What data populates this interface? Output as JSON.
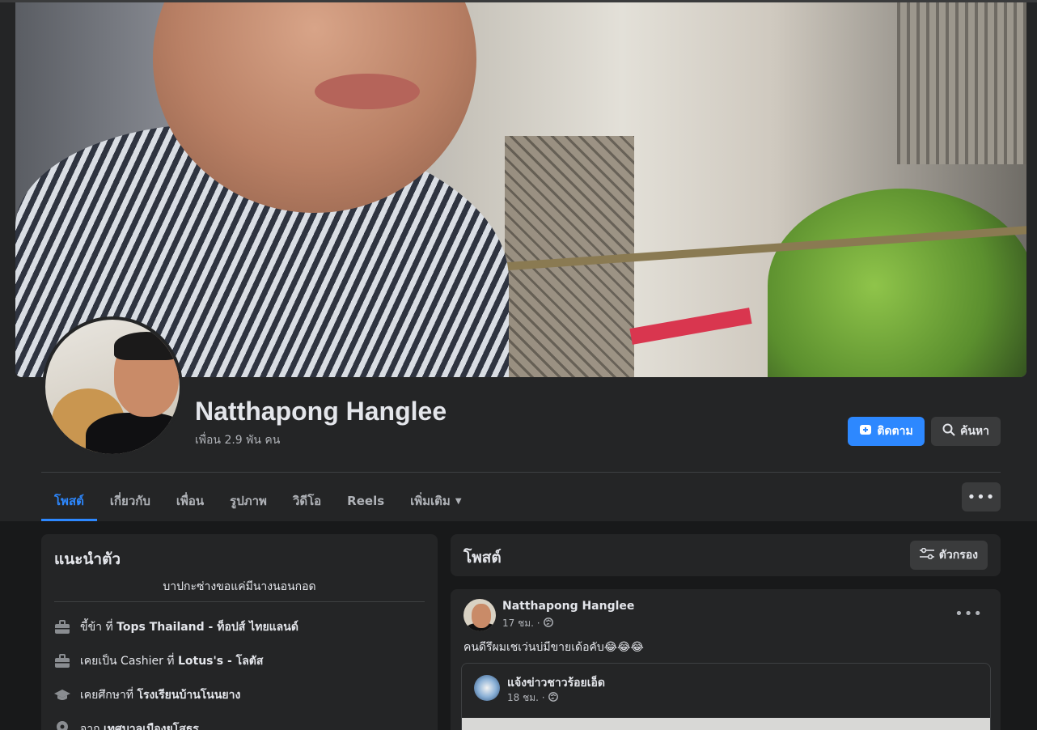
{
  "profile": {
    "name": "Natthapong Hanglee",
    "friends": "เพื่อน 2.9 พัน คน"
  },
  "actions": {
    "follow_label": "ติดตาม",
    "search_label": "ค้นหา",
    "more_label": "•••"
  },
  "tabs": [
    {
      "label": "โพสต์",
      "active": true
    },
    {
      "label": "เกี่ยวกับ"
    },
    {
      "label": "เพื่อน"
    },
    {
      "label": "รูปภาพ"
    },
    {
      "label": "วิดีโอ"
    },
    {
      "label": "Reels"
    },
    {
      "label": "เพิ่มเติม"
    }
  ],
  "intro": {
    "title": "แนะนำตัว",
    "bio": "บาปกะซ่างขอแค่มีนางนอนกอด",
    "rows": [
      {
        "icon": "briefcase-icon",
        "pre": "ขี้ข้า ที่ ",
        "bold": "Tops Thailand - ท็อปส์ ไทยแลนด์"
      },
      {
        "icon": "briefcase-icon",
        "pre": "เคยเป็น Cashier ที่ ",
        "bold": "Lotus's - โลตัส"
      },
      {
        "icon": "graduation-cap-icon",
        "pre": "เคยศึกษาที่ ",
        "bold": "โรงเรียนบ้านโนนยาง"
      },
      {
        "icon": "location-pin-icon",
        "pre": "จาก ",
        "bold": "เทศบาลเมืองยโสธร"
      }
    ]
  },
  "posts_header": {
    "title": "โพสต์",
    "filter_label": "ตัวกรอง"
  },
  "post": {
    "author": "Natthapong Hanglee",
    "time": "17 ชม. ·",
    "text": "คนดีรึผมเชเว่นบ่มีขายเด้อคับ😂😂😂",
    "shared": {
      "author": "แจ้งข่าวชาวร้อยเอ็ด",
      "time": "18 ชม. ·"
    }
  },
  "colors": {
    "accent": "#2d88ff",
    "background": "#18191a",
    "card": "#242526"
  }
}
